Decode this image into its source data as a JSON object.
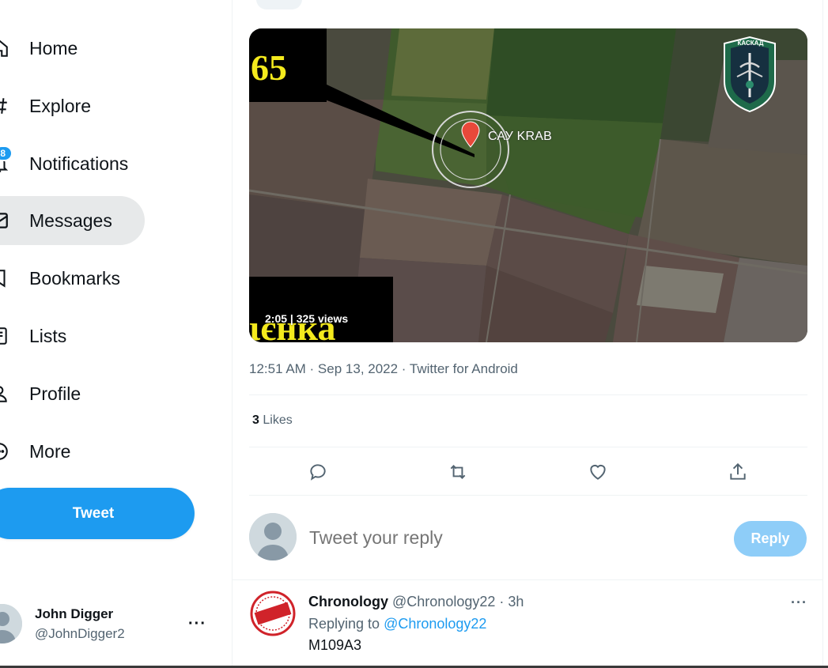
{
  "sidebar": {
    "items": [
      {
        "label": "Home",
        "icon": "home-icon"
      },
      {
        "label": "Explore",
        "icon": "hashtag-icon"
      },
      {
        "label": "Notifications",
        "icon": "bell-icon",
        "badge": "8"
      },
      {
        "label": "Messages",
        "icon": "envelope-icon",
        "active": true
      },
      {
        "label": "Bookmarks",
        "icon": "bookmark-icon"
      },
      {
        "label": "Lists",
        "icon": "list-icon"
      },
      {
        "label": "Profile",
        "icon": "person-icon"
      },
      {
        "label": "More",
        "icon": "more-circle-icon"
      }
    ],
    "tweet_button": "Tweet",
    "account": {
      "name": "John Digger",
      "handle": "@JohnDigger2",
      "more": "···"
    }
  },
  "tweet": {
    "media": {
      "number_overlay": "65",
      "bottom_overlay": "ιєнка",
      "marker_label": "САУ KRAB",
      "logo_text": "КАСКАД",
      "duration": "2:05",
      "views": "325 views"
    },
    "meta": "12:51 AM · Sep 13, 2022 · Twitter for Android",
    "likes_count": "3",
    "likes_label": "Likes",
    "actions": [
      "reply-icon",
      "retweet-icon",
      "like-icon",
      "share-icon"
    ]
  },
  "composer": {
    "placeholder": "Tweet your reply",
    "reply_button": "Reply"
  },
  "reply": {
    "avatar_text": "FACT",
    "name": "Chronology",
    "handle": "@Chronology22",
    "dot": "·",
    "time": "3h",
    "replying_prefix": "Replying to",
    "replying_to": "@Chronology22",
    "text": "M109A3",
    "more": "···"
  },
  "colors": {
    "accent": "#1d9bf0",
    "reply_disabled": "#8ecdf8",
    "active_bg": "#e7e9ea",
    "secondary_text": "#536471",
    "overlay_yellow": "#f4ea1d"
  }
}
